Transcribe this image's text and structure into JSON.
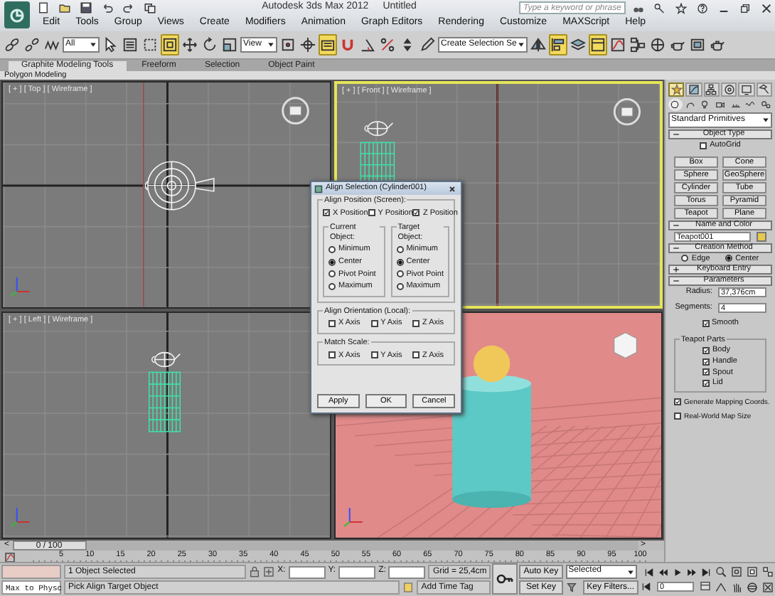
{
  "window": {
    "title": "Autodesk 3ds Max 2012",
    "document": "Untitled"
  },
  "search": {
    "placeholder": "Type a keyword or phrase"
  },
  "menu": [
    "Edit",
    "Tools",
    "Group",
    "Views",
    "Create",
    "Modifiers",
    "Animation",
    "Graph Editors",
    "Rendering",
    "Customize",
    "MAXScript",
    "Help"
  ],
  "toolbar": [
    {
      "kind": "link",
      "selected": false
    },
    {
      "kind": "unlink",
      "selected": false
    },
    {
      "kind": "bind",
      "selected": false
    },
    {
      "kind": "dropdown",
      "value": "All"
    },
    {
      "kind": "select",
      "selected": false
    },
    {
      "kind": "select-name",
      "selected": false
    },
    {
      "kind": "region",
      "selected": false
    },
    {
      "kind": "crossing",
      "selected": true
    },
    {
      "kind": "move",
      "selected": false
    },
    {
      "kind": "rotate",
      "selected": false
    },
    {
      "kind": "scale",
      "selected": false
    },
    {
      "kind": "dropdown",
      "value": "View"
    },
    {
      "kind": "pivot",
      "selected": false
    },
    {
      "kind": "manipulate",
      "selected": false
    },
    {
      "kind": "keyboard",
      "selected": true
    },
    {
      "kind": "snap",
      "selected": false
    },
    {
      "kind": "angle-snap",
      "selected": false
    },
    {
      "kind": "percent-snap",
      "selected": false
    },
    {
      "kind": "spinner-snap",
      "selected": false
    },
    {
      "kind": "edit-named",
      "selected": false
    },
    {
      "kind": "dropdown",
      "value": "Create Selection Se"
    },
    {
      "kind": "mirror",
      "selected": false
    },
    {
      "kind": "align",
      "selected": true
    },
    {
      "kind": "layer",
      "selected": false
    },
    {
      "kind": "graphite",
      "selected": true
    },
    {
      "kind": "curve",
      "selected": false
    },
    {
      "kind": "schematic",
      "selected": false
    },
    {
      "kind": "material",
      "selected": false
    },
    {
      "kind": "render-setup",
      "selected": false
    },
    {
      "kind": "frame",
      "selected": false
    },
    {
      "kind": "render",
      "selected": false
    }
  ],
  "ribbon": {
    "tabs": [
      {
        "label": "Graphite Modeling Tools",
        "selected": true
      },
      {
        "label": "Freeform",
        "selected": false
      },
      {
        "label": "Selection",
        "selected": false
      },
      {
        "label": "Object Paint",
        "selected": false
      }
    ],
    "panel": "Polygon Modeling"
  },
  "viewports": [
    {
      "kind": "top",
      "label": "[ + ] [ Top ] [ Wireframe ]",
      "active": false
    },
    {
      "kind": "front",
      "label": "[ + ] [ Front ] [ Wireframe ]",
      "active": true
    },
    {
      "kind": "left",
      "label": "[ + ] [ Left ] [ Wireframe ]",
      "active": false
    },
    {
      "kind": "perspective",
      "active": false
    }
  ],
  "dialog": {
    "title": "Align Selection (Cylinder001)",
    "position_title": "Align Position (Screen):",
    "axes": [
      {
        "label": "X Position",
        "checked": true
      },
      {
        "label": "Y Position",
        "checked": false
      },
      {
        "label": "Z Position",
        "checked": true
      }
    ],
    "groups": [
      {
        "title": "Current Object:",
        "options": [
          {
            "label": "Minimum",
            "selected": false
          },
          {
            "label": "Center",
            "selected": true
          },
          {
            "label": "Pivot Point",
            "selected": false
          },
          {
            "label": "Maximum",
            "selected": false
          }
        ]
      },
      {
        "title": "Target Object:",
        "options": [
          {
            "label": "Minimum",
            "selected": false
          },
          {
            "label": "Center",
            "selected": true
          },
          {
            "label": "Pivot Point",
            "selected": false
          },
          {
            "label": "Maximum",
            "selected": false
          }
        ]
      }
    ],
    "sections": [
      {
        "title": "Align Orientation (Local):",
        "axes": [
          {
            "label": "X Axis",
            "checked": false
          },
          {
            "label": "Y Axis",
            "checked": false
          },
          {
            "label": "Z Axis",
            "checked": false
          }
        ]
      },
      {
        "title": "Match Scale:",
        "axes": [
          {
            "label": "X Axis",
            "checked": false
          },
          {
            "label": "Y Axis",
            "checked": false
          },
          {
            "label": "Z Axis",
            "checked": false
          }
        ]
      }
    ],
    "buttons": [
      "Apply",
      "OK",
      "Cancel"
    ]
  },
  "command_panel": {
    "tabs": [
      {
        "kind": "create",
        "selected": true
      },
      {
        "kind": "modify",
        "selected": false
      },
      {
        "kind": "hierarchy",
        "selected": false
      },
      {
        "kind": "motion",
        "selected": false
      },
      {
        "kind": "display",
        "selected": false
      },
      {
        "kind": "utilities",
        "selected": false
      }
    ],
    "categories": [
      {
        "kind": "geometry",
        "selected": true
      },
      {
        "kind": "shapes",
        "selected": false
      },
      {
        "kind": "lights",
        "selected": false
      },
      {
        "kind": "cameras",
        "selected": false
      },
      {
        "kind": "helpers",
        "selected": false
      },
      {
        "kind": "spacewarps",
        "selected": false
      },
      {
        "kind": "systems",
        "selected": false
      }
    ],
    "dropdown": "Standard Primitives",
    "rollouts": [
      {
        "kind": "object_type",
        "title": "Object Type",
        "expanded": true,
        "autogrid": {
          "label": "AutoGrid",
          "checked": false
        },
        "buttons": [
          "Box",
          "Cone",
          "Sphere",
          "GeoSphere",
          "Cylinder",
          "Tube",
          "Torus",
          "Pyramid",
          "Teapot",
          "Plane"
        ]
      },
      {
        "kind": "name_color",
        "title": "Name and Color",
        "expanded": true,
        "name": "Teapot001",
        "color": "#e6c84c"
      },
      {
        "kind": "creation",
        "title": "Creation Method",
        "expanded": true,
        "options": [
          {
            "label": "Edge",
            "selected": false
          },
          {
            "label": "Center",
            "selected": true
          }
        ]
      },
      {
        "kind": "keyboard",
        "title": "Keyboard Entry",
        "expanded": false
      },
      {
        "kind": "parameters",
        "title": "Parameters",
        "expanded": true,
        "radius": {
          "label": "Radius:",
          "value": "37,376cm"
        },
        "segments": {
          "label": "Segments:",
          "value": "4"
        },
        "smooth": {
          "label": "Smooth",
          "checked": true
        },
        "parts_title": "Teapot Parts",
        "parts": [
          {
            "label": "Body",
            "checked": true
          },
          {
            "label": "Handle",
            "checked": true
          },
          {
            "label": "Spout",
            "checked": true
          },
          {
            "label": "Lid",
            "checked": true
          }
        ],
        "options": [
          {
            "label": "Generate Mapping Coords.",
            "checked": true
          },
          {
            "label": "Real-World Map Size",
            "checked": false
          }
        ]
      }
    ]
  },
  "timeline": {
    "left": "<",
    "position": "0 / 100",
    "level": 0,
    "right": ">",
    "ticks": [
      "5",
      "10",
      "15",
      "20",
      "25",
      "30",
      "35",
      "40",
      "45",
      "50",
      "55",
      "60",
      "65",
      "70",
      "75",
      "80",
      "85",
      "90",
      "95",
      "100"
    ]
  },
  "status_bar": {
    "listener": "Max to Physc",
    "selection": "1 Object Selected",
    "prompt": "Pick Align Target Object",
    "coords": [
      {
        "label": "X:"
      },
      {
        "label": "Y:"
      },
      {
        "label": "Z:"
      }
    ],
    "grid": "Grid = 25,4cm",
    "time_tag": "Add Time Tag",
    "auto_key": "Auto Key",
    "set_key": "Set Key",
    "key_mode": "Selected",
    "key_filters": "Key Filters...",
    "frame": "0"
  }
}
